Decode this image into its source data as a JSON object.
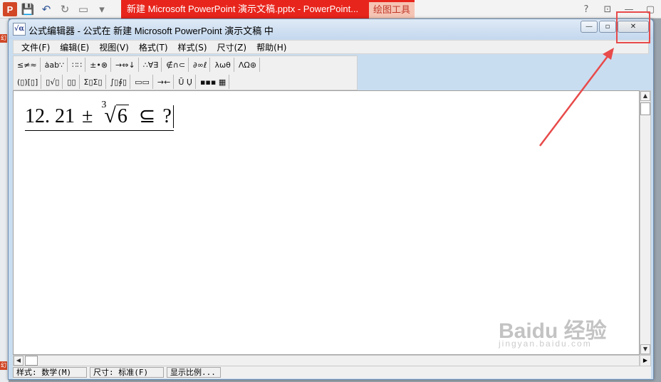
{
  "ppt_window": {
    "logo": "P",
    "title": "新建 Microsoft PowerPoint 演示文稿.pptx - PowerPoint...",
    "contextual_tab": "绘图工具",
    "controls": [
      "?",
      "⊡",
      "—",
      "▢"
    ],
    "left_strip_marks": [
      "幻",
      "幻"
    ]
  },
  "eq_window": {
    "icon": "√α",
    "title": "公式编辑器 - 公式在 新建 Microsoft PowerPoint 演示文稿 中",
    "min": "—",
    "restore": "▫",
    "close": "✕"
  },
  "menu": [
    {
      "label": "文件(F)"
    },
    {
      "label": "编辑(E)"
    },
    {
      "label": "视图(V)"
    },
    {
      "label": "格式(T)"
    },
    {
      "label": "样式(S)"
    },
    {
      "label": "尺寸(Z)"
    },
    {
      "label": "帮助(H)"
    }
  ],
  "toolbar": {
    "row1": [
      "≤≠≈",
      "ȧab∵",
      "∷∷",
      "±•⊗",
      "→⇔↓",
      "∴∀∃",
      "∉∩⊂",
      "∂∞ℓ",
      "λωθ",
      "ΛΩ⊛"
    ],
    "row2": [
      "(▯)[▯]",
      "▯√▯",
      "▯▯",
      "Σ▯Σ▯",
      "∫▯∮▯",
      "▭▭",
      "→←",
      "Ū Ụ",
      "▪▪▪ ▦"
    ]
  },
  "formula": {
    "number": "12. 21",
    "operator": "±",
    "root_index": "3",
    "radical_sign": "√",
    "radicand": "6",
    "subset": "⊆",
    "question": "?"
  },
  "scroll": {
    "up": "▲",
    "down": "▼",
    "left": "◀",
    "right": "▶"
  },
  "status": {
    "style": "样式: 数学(M)",
    "size": "尺寸: 标准(F)",
    "zoom": "显示比例..."
  },
  "watermark": {
    "main": "Baidu 经验",
    "sub": "jingyan.baidu.com"
  },
  "colors": {
    "ppt_accent": "#e8251c",
    "annotation": "#e84a4a"
  }
}
